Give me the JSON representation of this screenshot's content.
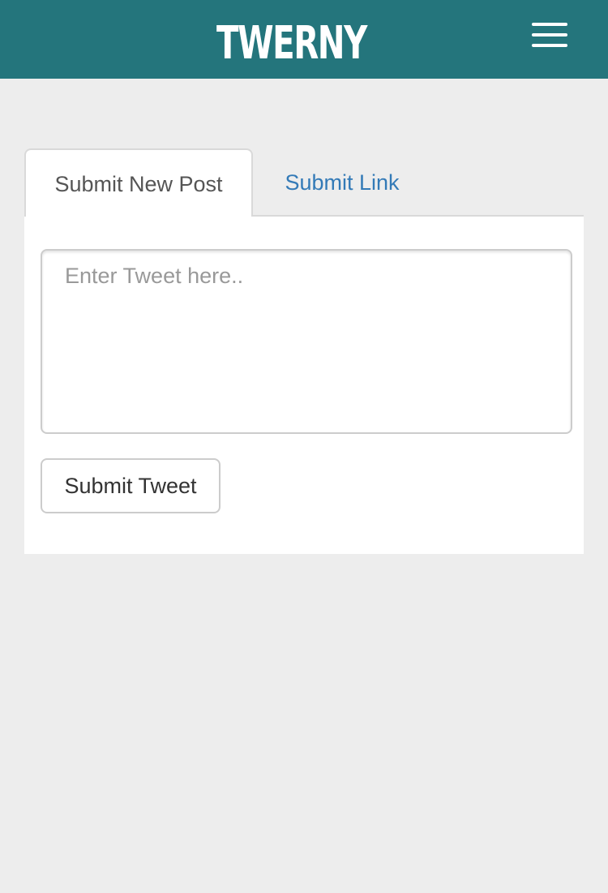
{
  "header": {
    "logo_text": "TWERNY",
    "logo_emblem_letter": "T",
    "background_color": "#24757c",
    "menu_icon": "hamburger-menu-icon"
  },
  "tabs": [
    {
      "label": "Submit New Post",
      "active": true
    },
    {
      "label": "Submit Link",
      "active": false
    }
  ],
  "form": {
    "tweet_value": "",
    "tweet_placeholder": "Enter Tweet here..",
    "submit_label": "Submit Tweet"
  },
  "colors": {
    "page_background": "#ededed",
    "link": "#337ab7"
  }
}
